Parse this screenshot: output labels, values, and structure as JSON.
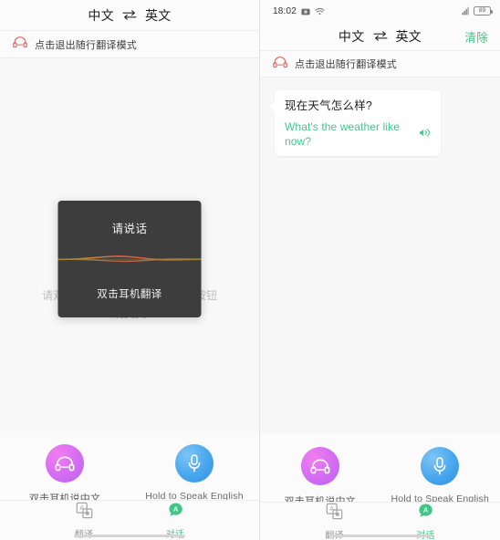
{
  "left_panel": {
    "header": {
      "source_lang": "中文",
      "swap_icon": "swap-horizontal-icon",
      "target_lang": "英文"
    },
    "banner": {
      "icon": "headphone-icon",
      "text": "点击退出随行翻译模式"
    },
    "hint_text": "请双击耳机说中文，或按住屏幕按钮\n说英文",
    "modal": {
      "title": "请说话",
      "waveform_icon": "audio-waveform-icon",
      "subtitle": "双击耳机翻译"
    },
    "actions": [
      {
        "icon": "headphone-icon",
        "label": "双击耳机说中文",
        "style": "pink"
      },
      {
        "icon": "microphone-icon",
        "label": "Hold to Speak English",
        "style": "blue"
      }
    ],
    "tabs": [
      {
        "icon": "translate-icon",
        "label": "翻译",
        "active": false
      },
      {
        "icon": "conversation-icon",
        "label": "对话",
        "active": true
      }
    ]
  },
  "right_panel": {
    "status_bar": {
      "time": "18:02",
      "icons": [
        "camera-icon",
        "wifi-icon"
      ],
      "signal_icon": "signal-icon",
      "battery_level": "89"
    },
    "header": {
      "source_lang": "中文",
      "swap_icon": "swap-horizontal-icon",
      "target_lang": "英文",
      "clear_label": "清除"
    },
    "banner": {
      "icon": "headphone-icon",
      "text": "点击退出随行翻译模式"
    },
    "messages": [
      {
        "source": "现在天气怎么样?",
        "translation": "What's the weather like now?",
        "speaker_icon": "speaker-icon"
      }
    ],
    "actions": [
      {
        "icon": "headphone-icon",
        "label": "双击耳机说中文",
        "style": "pink"
      },
      {
        "icon": "microphone-icon",
        "label": "Hold to Speak English",
        "style": "blue"
      }
    ],
    "tabs": [
      {
        "icon": "translate-icon",
        "label": "翻译",
        "active": false
      },
      {
        "icon": "conversation-icon",
        "label": "对话",
        "active": true
      }
    ]
  },
  "colors": {
    "accent_green": "#3ec786",
    "banner_red": "#e8645c",
    "modal_bg": "#3d3d3d",
    "pink_button": "#d86ef2",
    "blue_button": "#4aa8ee"
  }
}
